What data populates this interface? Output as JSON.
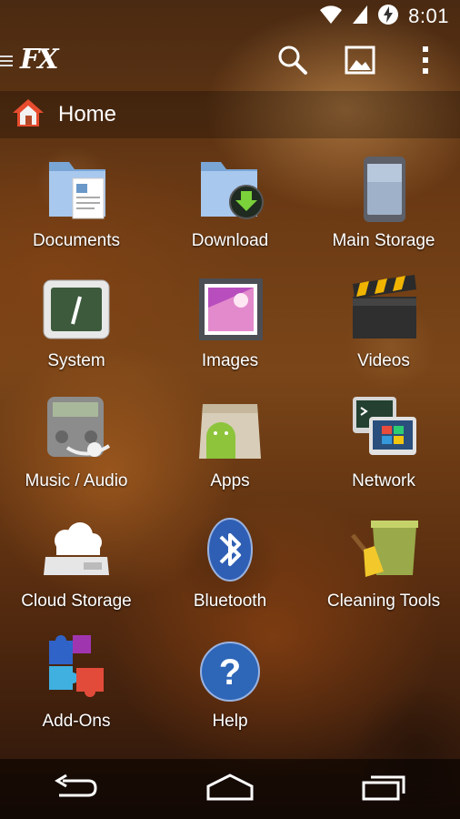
{
  "status_bar": {
    "time": "8:01",
    "icons": [
      "wifi-icon",
      "signal-icon",
      "battery-charging-icon"
    ]
  },
  "action_bar": {
    "logo": "FX",
    "buttons": [
      "search-icon",
      "image-icon",
      "overflow-menu-icon"
    ]
  },
  "breadcrumb": {
    "label": "Home",
    "icon": "home-icon"
  },
  "tiles": [
    {
      "label": "Documents",
      "icon": "documents-folder-icon"
    },
    {
      "label": "Download",
      "icon": "download-folder-icon"
    },
    {
      "label": "Main Storage",
      "icon": "main-storage-icon"
    },
    {
      "label": "System",
      "icon": "system-icon"
    },
    {
      "label": "Images",
      "icon": "images-icon"
    },
    {
      "label": "Videos",
      "icon": "videos-icon"
    },
    {
      "label": "Music / Audio",
      "icon": "music-audio-icon"
    },
    {
      "label": "Apps",
      "icon": "apps-icon"
    },
    {
      "label": "Network",
      "icon": "network-icon"
    },
    {
      "label": "Cloud Storage",
      "icon": "cloud-storage-icon"
    },
    {
      "label": "Bluetooth",
      "icon": "bluetooth-icon"
    },
    {
      "label": "Cleaning Tools",
      "icon": "cleaning-tools-icon"
    },
    {
      "label": "Add-Ons",
      "icon": "add-ons-icon"
    },
    {
      "label": "Help",
      "icon": "help-icon"
    }
  ],
  "nav_bar": {
    "buttons": [
      "back-icon",
      "home-icon",
      "recents-icon"
    ]
  }
}
